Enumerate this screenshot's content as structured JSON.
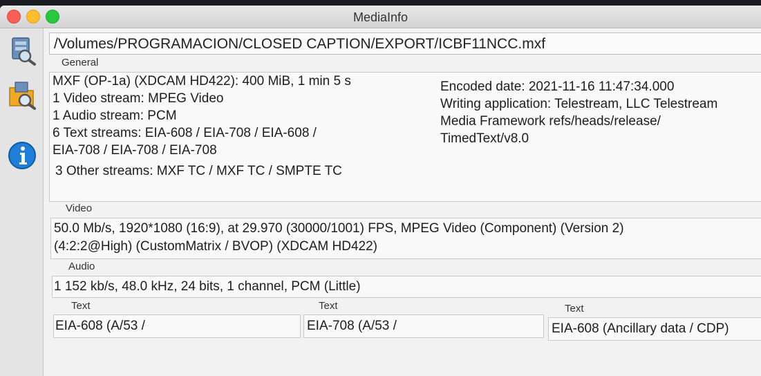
{
  "window": {
    "title": "MediaInfo"
  },
  "sidebar": {
    "icons": [
      "media-sheet-search-icon",
      "media-folder-search-icon",
      "info-icon"
    ]
  },
  "file": {
    "path": "/Volumes/PROGRAMACION/CLOSED CAPTION/EXPORT/ICBF11NCC.mxf"
  },
  "general": {
    "label": "General",
    "left_lines": [
      "MXF (OP-1a) (XDCAM HD422): 400 MiB, 1 min 5 s",
      "1 Video stream: MPEG Video",
      "1 Audio stream: PCM",
      "6 Text streams: EIA-608 / EIA-708 / EIA-608 /",
      "EIA-708 / EIA-708 / EIA-708",
      "3 Other streams: MXF TC / MXF TC / SMPTE TC"
    ],
    "right_lines": [
      "Encoded date: 2021-11-16 11:47:34.000",
      "Writing application: Telestream, LLC Telestream",
      "Media Framework refs/heads/release/",
      "TimedText/v8.0"
    ]
  },
  "video": {
    "label": "Video",
    "lines": [
      "50.0 Mb/s, 1920*1080 (16:9), at 29.970 (30000/1001) FPS, MPEG Video (Component) (Version 2)",
      "(4:2:2@High) (CustomMatrix / BVOP) (XDCAM HD422)"
    ]
  },
  "audio": {
    "label": "Audio",
    "lines": [
      "1 152 kb/s, 48.0 kHz, 24 bits, 1 channel, PCM (Little)"
    ]
  },
  "text_streams": [
    {
      "label": "Text",
      "value": "EIA-608 (A/53 /"
    },
    {
      "label": "Text",
      "value": "EIA-708 (A/53 /"
    },
    {
      "label": "Text",
      "value": "EIA-608 (Ancillary data / CDP)"
    }
  ],
  "colors": {
    "close": "#fb5f57",
    "minimize": "#fdbd2e",
    "maximize": "#27c840",
    "info_blue": "#1f7fd6"
  }
}
